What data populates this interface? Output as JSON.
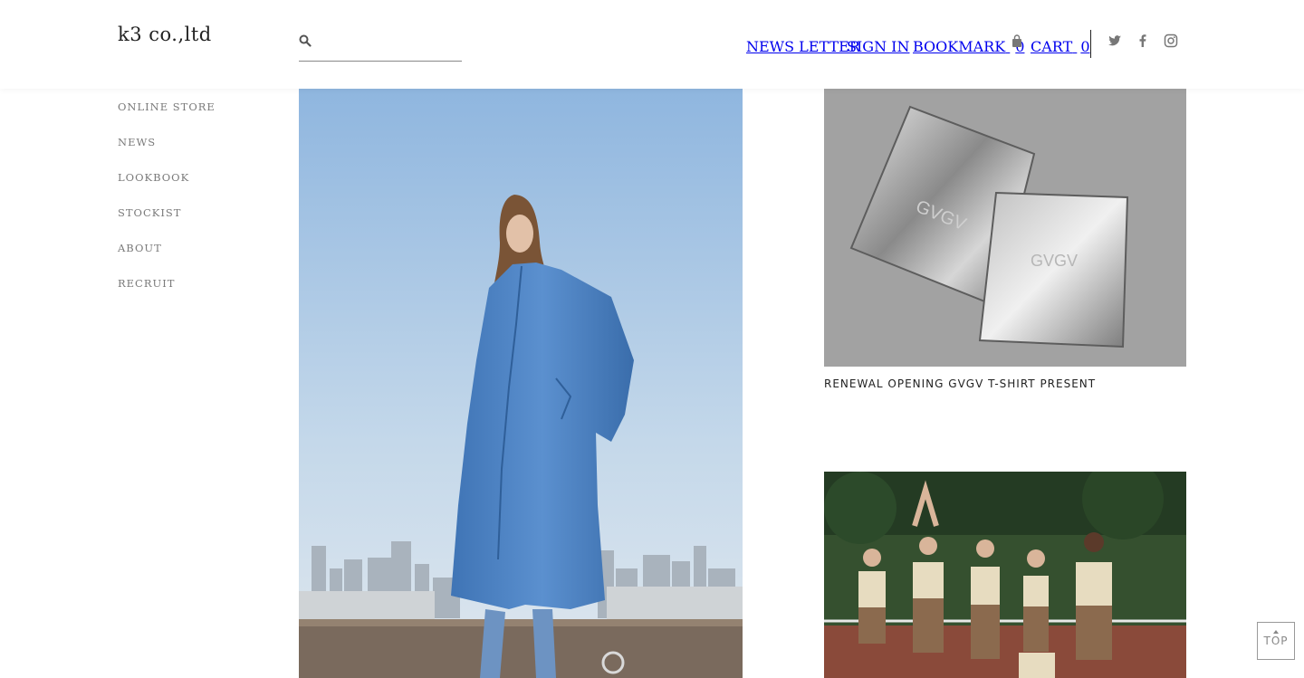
{
  "brand": {
    "logo_text": "k3 co.,ltd"
  },
  "search": {
    "placeholder": "",
    "value": "",
    "icon": "search-icon"
  },
  "header_nav": {
    "newsletter": "NEWS LETTER",
    "signin": "SIGN IN",
    "bookmark_label": "BOOKMARK",
    "bookmark_count": "0",
    "cart_label": "CART",
    "cart_count": "0"
  },
  "social": [
    "twitter-icon",
    "facebook-icon",
    "instagram-icon"
  ],
  "sidebar": {
    "items": [
      {
        "label": "ONLINE STORE"
      },
      {
        "label": "NEWS"
      },
      {
        "label": "LOOKBOOK"
      },
      {
        "label": "STOCKIST"
      },
      {
        "label": "ABOUT"
      },
      {
        "label": "RECRUIT"
      }
    ]
  },
  "feed": {
    "cards": [
      {
        "title": "RENEWAL OPENING GVGV T-SHIRT PRESENT",
        "image_text": "GVGV"
      },
      {
        "title": ""
      }
    ]
  },
  "top_button": {
    "label": "TOP"
  }
}
